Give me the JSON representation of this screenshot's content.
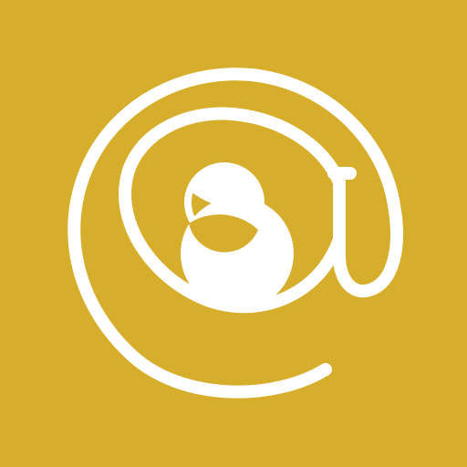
{
  "icon": {
    "name": "at-sign-logo-icon",
    "background_color": "#d6ae2b",
    "foreground_color": "#ffffff"
  }
}
